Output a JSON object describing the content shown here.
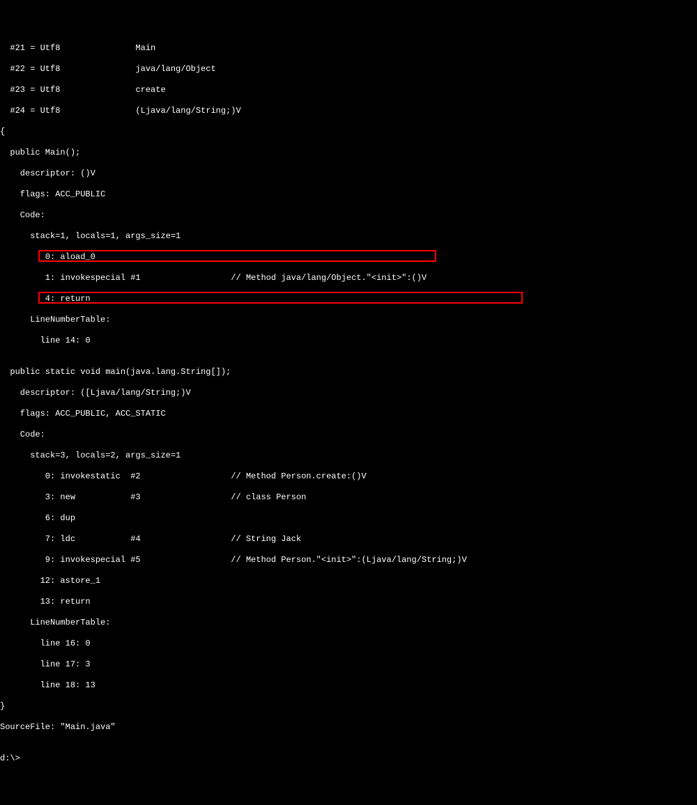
{
  "lines": {
    "cp21": "  #21 = Utf8               Main",
    "cp22": "  #22 = Utf8               java/lang/Object",
    "cp23": "  #23 = Utf8               create",
    "cp24": "  #24 = Utf8               (Ljava/lang/String;)V",
    "brace": "{",
    "ctor_sig": "  public Main();",
    "ctor_desc": "    descriptor: ()V",
    "ctor_flags": "    flags: ACC_PUBLIC",
    "ctor_code": "    Code:",
    "ctor_stack": "      stack=1, locals=1, args_size=1",
    "ctor_i0": "         0: aload_0",
    "ctor_i1": "         1: invokespecial #1                  // Method java/lang/Object.\"<init>\":()V",
    "ctor_i4": "         4: return",
    "ctor_lnt": "      LineNumberTable:",
    "ctor_ln14": "        line 14: 0",
    "blank": "",
    "main_sig": "  public static void main(java.lang.String[]);",
    "main_desc": "    descriptor: ([Ljava/lang/String;)V",
    "main_flags": "    flags: ACC_PUBLIC, ACC_STATIC",
    "main_code": "    Code:",
    "main_stack": "      stack=3, locals=2, args_size=1",
    "main_i0": "         0: invokestatic  #2                  // Method Person.create:()V",
    "main_i3": "         3: new           #3                  // class Person",
    "main_i6": "         6: dup",
    "main_i7": "         7: ldc           #4                  // String Jack",
    "main_i9": "         9: invokespecial #5                  // Method Person.\"<init>\":(Ljava/lang/String;)V",
    "main_i12": "        12: astore_1",
    "main_i13": "        13: return",
    "main_lnt": "      LineNumberTable:",
    "main_ln16": "        line 16: 0",
    "main_ln17": "        line 17: 3",
    "main_ln18": "        line 18: 13",
    "brace_close": "}",
    "src": "SourceFile: \"Main.java\"",
    "blank2": "",
    "prompt": "d:\\>"
  }
}
